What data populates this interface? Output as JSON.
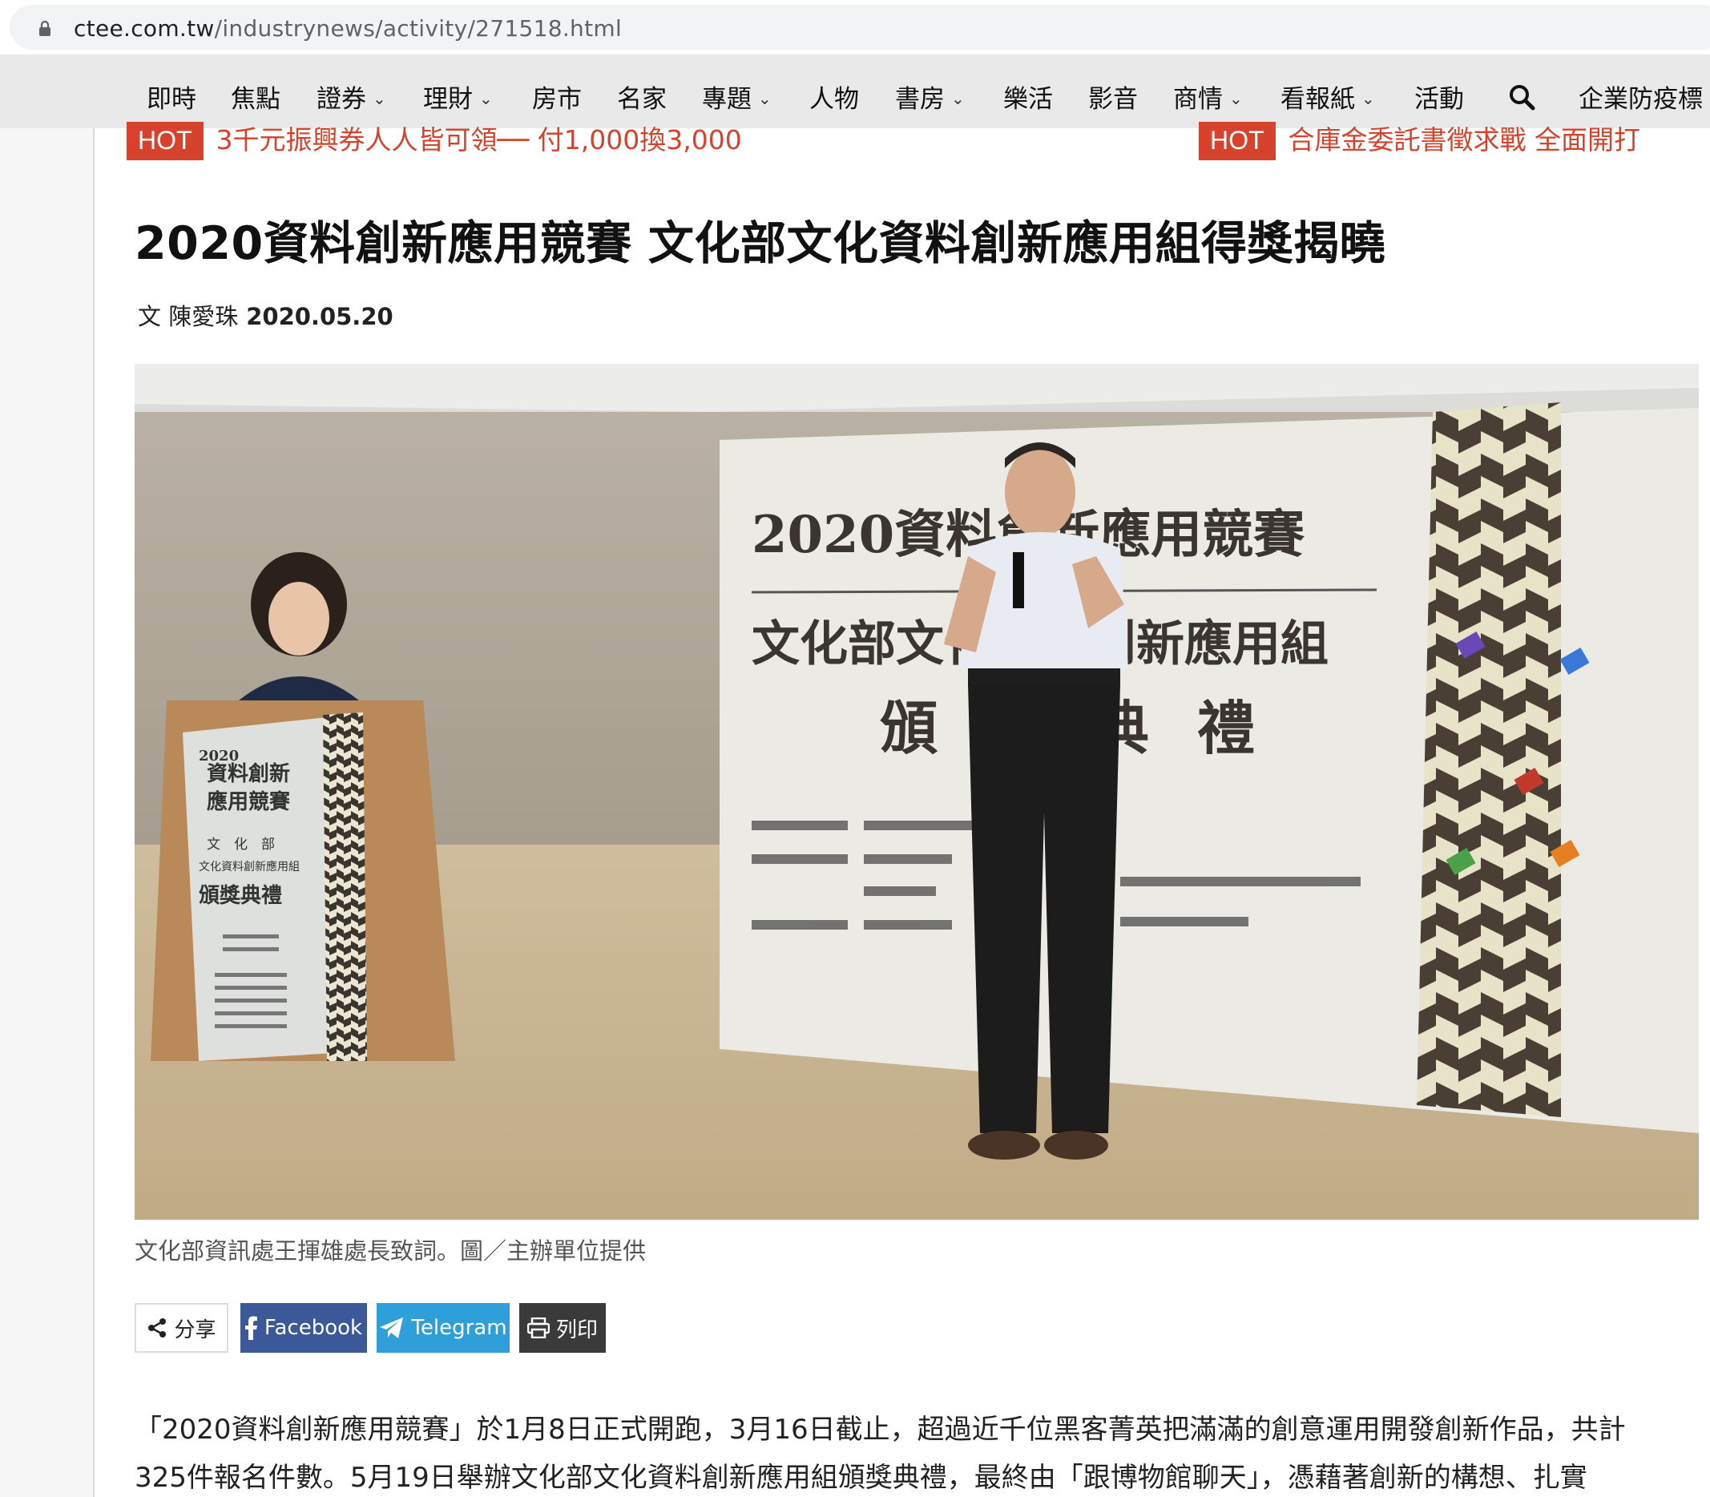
{
  "browser": {
    "url_host": "ctee.com.tw",
    "url_path": "/industrynews/activity/271518.html"
  },
  "nav": {
    "items": [
      {
        "label": "即時",
        "has_menu": false
      },
      {
        "label": "焦點",
        "has_menu": false
      },
      {
        "label": "證券",
        "has_menu": true
      },
      {
        "label": "理財",
        "has_menu": true
      },
      {
        "label": "房市",
        "has_menu": false
      },
      {
        "label": "名家",
        "has_menu": false
      },
      {
        "label": "專題",
        "has_menu": true
      },
      {
        "label": "人物",
        "has_menu": false
      },
      {
        "label": "書房",
        "has_menu": true
      },
      {
        "label": "樂活",
        "has_menu": false
      },
      {
        "label": "影音",
        "has_menu": false
      },
      {
        "label": "商情",
        "has_menu": true
      },
      {
        "label": "看報紙",
        "has_menu": true
      },
      {
        "label": "活動",
        "has_menu": false
      }
    ],
    "extra_label": "企業防疫標",
    "search_icon": "search-icon"
  },
  "hot": [
    {
      "badge": "HOT",
      "text": "3千元振興券人人皆可領── 付1,000換3,000"
    },
    {
      "badge": "HOT",
      "text": "合庫金委託書徵求戰 全面開打"
    }
  ],
  "article": {
    "title": "2020資料創新應用競賽 文化部文化資料創新應用組得獎揭曉",
    "author": "文 陳愛珠",
    "date": "2020.05.20",
    "photo_caption": "文化部資訊處王揮雄處長致詞。圖／主辦單位提供",
    "paragraph_lines": [
      "「2020資料創新應用競賽」於1月8日正式開跑，3月16日截止，超過近千位黑客菁英把滿滿的創意運用開發創新作品，共計",
      "325件報名件數。5月19日舉辦文化部文化資料創新應用組頒獎典禮，最終由「跟博物館聊天」，憑藉著創新的構想、扎實"
    ]
  },
  "photo": {
    "backdrop_title": "2020資料創新應用競賽",
    "backdrop_line2": "文化部文化資料創新應用組",
    "backdrop_line3": "頒獎典禮",
    "podium_year": "2020",
    "podium_title1": "資料創新",
    "podium_title2": "應用競賽",
    "podium_line3": "文　化　部",
    "podium_line4": "文化資料創新應用組",
    "podium_line5": "頒獎典禮"
  },
  "share": {
    "label": "分享",
    "facebook": "Facebook",
    "telegram": "Telegram",
    "print": "列印"
  }
}
